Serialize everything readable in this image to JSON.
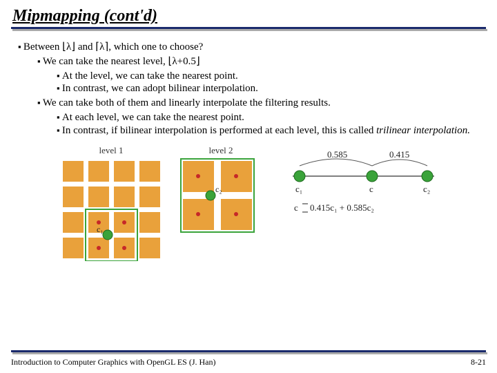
{
  "title": "Mipmapping (cont'd)",
  "bullets": {
    "b1_pre": "Between ",
    "b1_mid": " and ",
    "b1_post": ", which one to choose?",
    "floor_lambda": "⌊λ⌋",
    "ceil_lambda": "⌈λ⌉",
    "b1a_pre": "We can take the nearest level, ",
    "b1a_expr": "⌊λ+0.5⌋",
    "b1a1": "At the level, we can take the nearest point.",
    "b1a2": "In contrast, we can adopt bilinear interpolation.",
    "b1b": "We can take both of them and linearly interpolate the filtering results.",
    "b1b1": "At each level, we can take the nearest point.",
    "b1b2_pre": "In contrast, if bilinear interpolation is performed at each level, this is called ",
    "b1b2_em": "trilinear interpolation."
  },
  "figure": {
    "level1_label": "level 1",
    "level2_label": "level 2",
    "c1": "c₁",
    "c2": "c₂",
    "w1": "0.585",
    "w2": "0.415",
    "eq_c": "c",
    "eq": "0.415c₁ + 0.585c₂"
  },
  "footer": {
    "text": "Introduction to Computer Graphics with OpenGL ES (J. Han)",
    "page": "8-21"
  }
}
